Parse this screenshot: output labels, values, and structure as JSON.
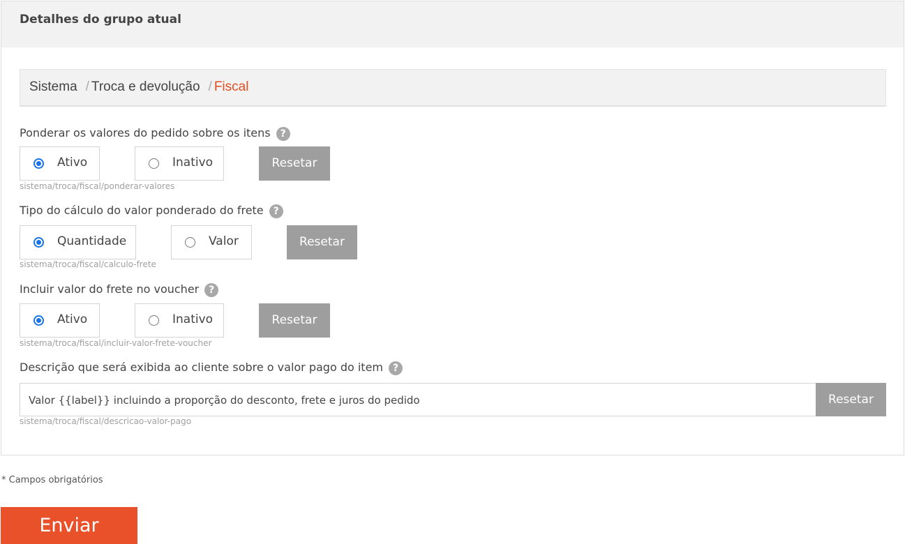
{
  "panel": {
    "title": "Detalhes do grupo atual"
  },
  "breadcrumb": {
    "items": [
      "Sistema",
      "Troca e devolução",
      "Fiscal"
    ],
    "separator": "/"
  },
  "fields": [
    {
      "label": "Ponderar os valores do pedido sobre os itens",
      "options": [
        {
          "label": "Ativo",
          "checked": true
        },
        {
          "label": "Inativo",
          "checked": false
        }
      ],
      "reset_label": "Resetar",
      "key": "sistema/troca/fiscal/ponderar-valores"
    },
    {
      "label": "Tipo do cálculo do valor ponderado do frete",
      "options": [
        {
          "label": "Quantidade",
          "checked": true
        },
        {
          "label": "Valor",
          "checked": false
        }
      ],
      "reset_label": "Resetar",
      "key": "sistema/troca/fiscal/calculo-frete"
    },
    {
      "label": "Incluir valor do frete no voucher",
      "options": [
        {
          "label": "Ativo",
          "checked": true
        },
        {
          "label": "Inativo",
          "checked": false
        }
      ],
      "reset_label": "Resetar",
      "key": "sistema/troca/fiscal/incluir-valor-frete-voucher"
    },
    {
      "label": "Descrição que será exibida ao cliente sobre o valor pago do item",
      "value": "Valor {{label}} incluindo a proporção do desconto, frete e juros do pedido",
      "reset_label": "Resetar",
      "key": "sistema/troca/fiscal/descricao-valor-pago"
    }
  ],
  "help_glyph": "?",
  "required_note": "* Campos obrigatórios",
  "submit_label": "Enviar",
  "colors": {
    "accent": "#e8512a",
    "breadcrumb_active": "#e04f20",
    "reset_button": "#9e9e9e",
    "radio_checked": "#1a73e8"
  }
}
